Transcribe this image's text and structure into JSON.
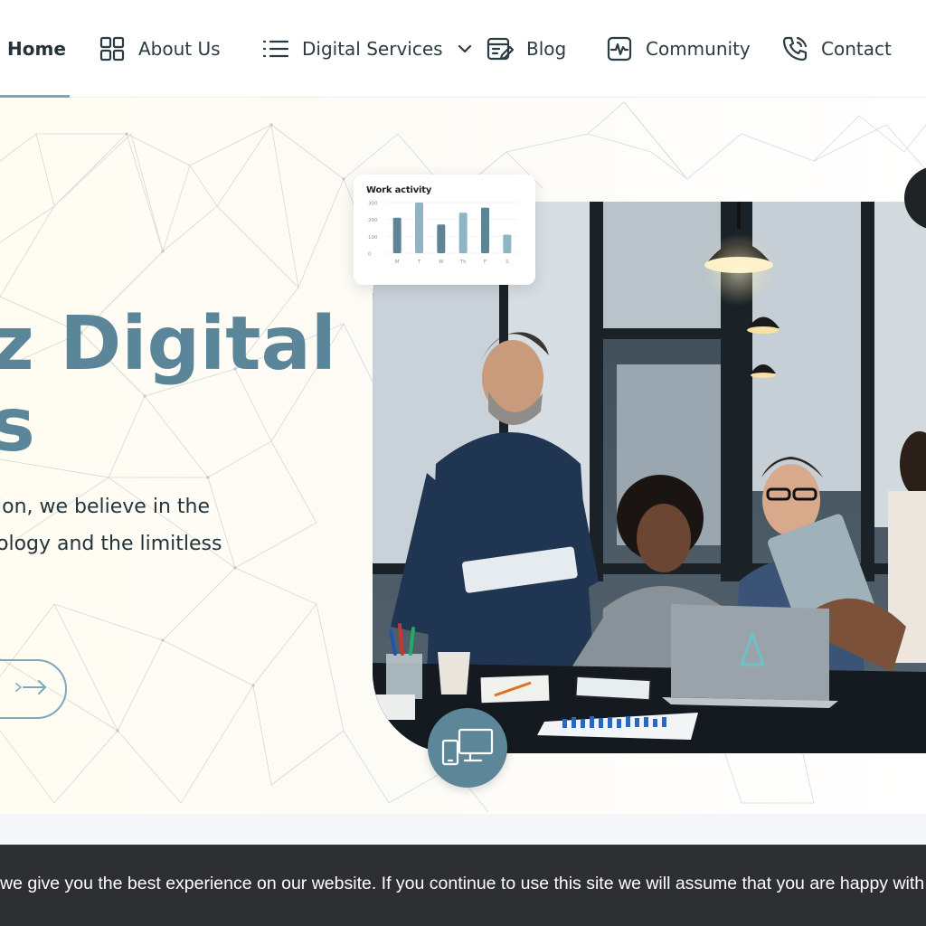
{
  "nav": {
    "items": [
      {
        "label": "Home",
        "icon": "none"
      },
      {
        "label": "About Us",
        "icon": "grid-icon"
      },
      {
        "label": "Digital Services",
        "icon": "list-icon"
      },
      {
        "label": "Blog",
        "icon": "edit-note-icon"
      },
      {
        "label": "Community",
        "icon": "pulse-icon"
      },
      {
        "label": "Contact",
        "icon": "phone-icon"
      }
    ],
    "active": "Home"
  },
  "hero": {
    "title": "z Digital\ns",
    "text": "ion, we believe in the\nology and the limitless",
    "button_icon": "arrow-right-icon"
  },
  "work_activity": {
    "title": "Work activity",
    "chart_data": {
      "type": "bar",
      "categories": [
        "M",
        "T",
        "W",
        "Th",
        "F",
        "S"
      ],
      "values": [
        210,
        310,
        170,
        240,
        270,
        110
      ],
      "ylim": [
        0,
        300
      ],
      "yticks": [
        "300",
        "200",
        "100",
        "0"
      ],
      "colors": [
        "#5e8597",
        "#8fb4c4",
        "#5e8597",
        "#8fb4c4",
        "#5e8597",
        "#8fb4c4"
      ]
    }
  },
  "badges": {
    "device_icon": "devices-icon"
  },
  "cookie": {
    "text": "we give you the best experience on our website. If you continue to use this site we will assume that you are happy with it."
  },
  "colors": {
    "accent": "#5b8598",
    "cookie_bg": "#2e2f33"
  }
}
